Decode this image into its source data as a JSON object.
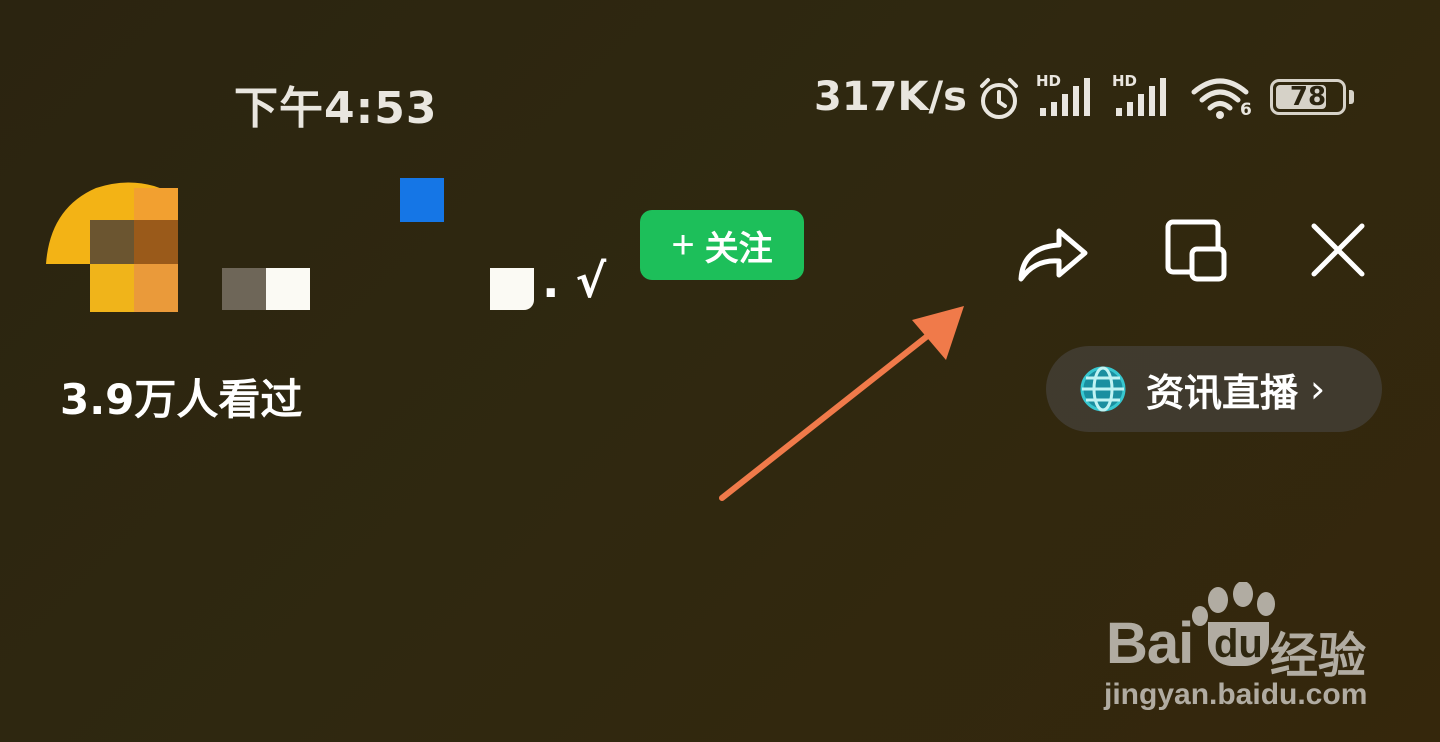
{
  "status_bar": {
    "time": "下午4:53",
    "net_speed": "317K/s",
    "signal1_label": "HD",
    "signal2_label": "HD",
    "wifi_label": "6",
    "battery": "78",
    "icons": [
      "alarm-icon",
      "signal-hd-icon",
      "signal-hd-icon",
      "wifi-6-icon",
      "battery-icon"
    ]
  },
  "header": {
    "follow_label": "关注",
    "follow_icon": "plus-icon",
    "name_suffix": ". √",
    "actions": [
      "share-icon",
      "minimize-window-icon",
      "close-icon"
    ]
  },
  "views_text": "3.9万人看过",
  "live_pill": {
    "label": "资讯直播",
    "icon": "globe-icon",
    "chevron": "›"
  },
  "watermark": {
    "brand": "Bai",
    "brand_du": "du",
    "suffix": "经验",
    "url": "jingyan.baidu.com"
  },
  "colors": {
    "follow_bg": "#1dbf5a",
    "annotation_arrow": "#f07a4a",
    "background": "#2f2810"
  }
}
